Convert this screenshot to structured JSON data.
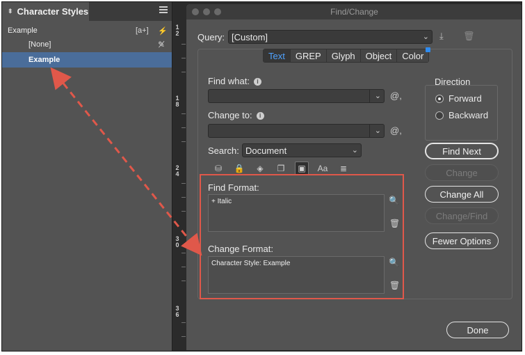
{
  "panel": {
    "title": "Character Styles",
    "group": "Example",
    "group_tool_1": "[a+]",
    "group_tool_2": "⚡",
    "styles": [
      {
        "label": "[None]"
      },
      {
        "label": "Example"
      }
    ]
  },
  "ruler": {
    "marks": [
      {
        "label": "1\n2"
      },
      {
        "label": "1\n8"
      },
      {
        "label": "2\n4"
      },
      {
        "label": "3\n0"
      },
      {
        "label": "3\n6"
      }
    ]
  },
  "dialog": {
    "title": "Find/Change",
    "query_label": "Query:",
    "query_value": "[Custom]",
    "tabs": [
      "Text",
      "GREP",
      "Glyph",
      "Object",
      "Color"
    ],
    "active_tab": "Text",
    "find_what_label": "Find what:",
    "find_what_value": "",
    "change_to_label": "Change to:",
    "change_to_value": "",
    "search_label": "Search:",
    "search_value": "Document",
    "find_format_label": "Find Format:",
    "find_format_value": "+ Italic",
    "change_format_label": "Change Format:",
    "change_format_value": "Character Style: Example",
    "direction_label": "Direction",
    "direction_options": [
      "Forward",
      "Backward"
    ],
    "direction_selected": "Forward",
    "buttons": {
      "find_next": "Find Next",
      "change": "Change",
      "change_all": "Change All",
      "change_find": "Change/Find",
      "fewer_options": "Fewer Options",
      "done": "Done"
    },
    "special_char_glyph": "@,",
    "toolbar_icons": [
      "lock-layers-icon",
      "locked-stories-icon",
      "hidden-layers-icon",
      "master-pages-icon",
      "footnotes-icon",
      "case-sensitive-icon",
      "whole-word-icon"
    ],
    "toolbar_glyphs": [
      "⛁",
      "🔒",
      "◈",
      "❐",
      "▣",
      "Aa",
      "≣"
    ]
  },
  "colors": {
    "accent": "#4fa3ff",
    "highlight": "#e0584a",
    "selection": "#4a6d9a"
  }
}
